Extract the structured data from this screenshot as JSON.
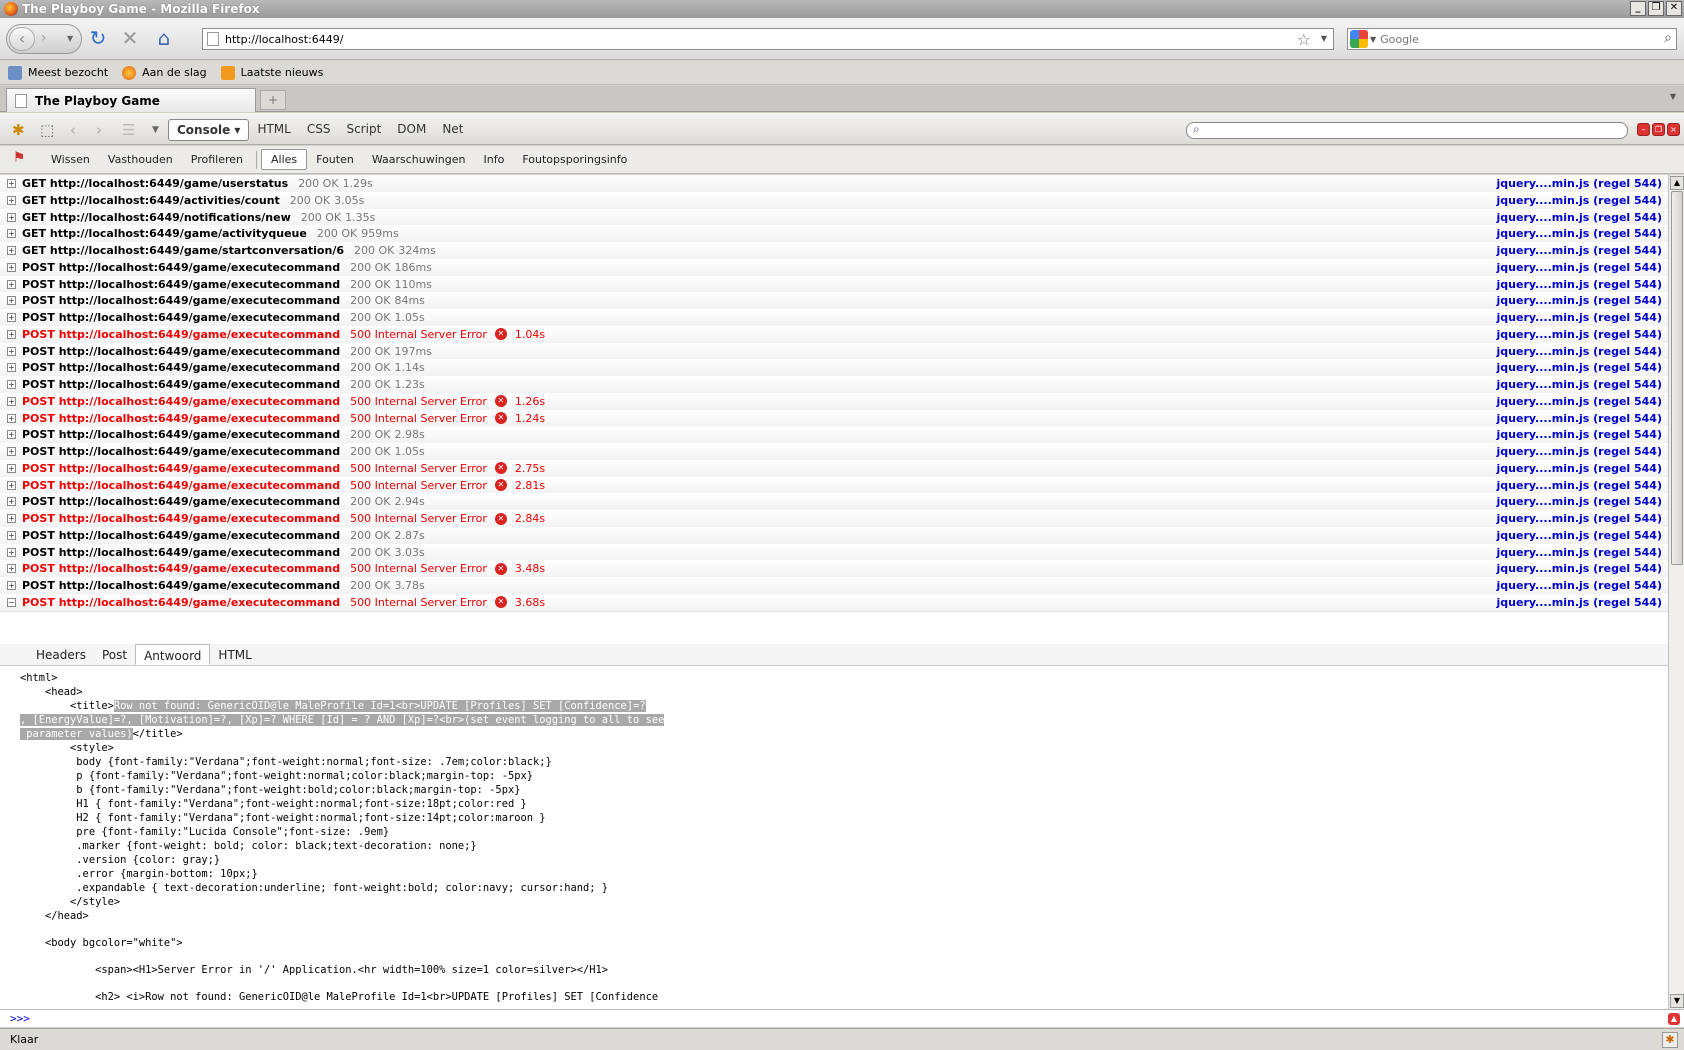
{
  "window": {
    "title": "The Playboy Game - Mozilla Firefox"
  },
  "nav": {
    "url": "http://localhost:6449/",
    "search_placeholder": "Google"
  },
  "bookmarks": [
    {
      "label": "Meest bezocht"
    },
    {
      "label": "Aan de slag"
    },
    {
      "label": "Laatste nieuws"
    }
  ],
  "tab": {
    "title": "The Playboy Game"
  },
  "firebug": {
    "tabs": [
      "Console",
      "HTML",
      "CSS",
      "Script",
      "DOM",
      "Net"
    ],
    "console_filters": [
      "Wissen",
      "Vasthouden",
      "Profileren",
      "Alles",
      "Fouten",
      "Waarschuwingen",
      "Info",
      "Foutopsporingsinfo"
    ]
  },
  "requests": [
    {
      "method": "GET",
      "url": "http://localhost:6449/game/userstatus",
      "status": "200 OK",
      "time": "1.29s",
      "source": "jquery....min.js (regel 544)",
      "error": false
    },
    {
      "method": "GET",
      "url": "http://localhost:6449/activities/count",
      "status": "200 OK",
      "time": "3.05s",
      "source": "jquery....min.js (regel 544)",
      "error": false
    },
    {
      "method": "GET",
      "url": "http://localhost:6449/notifications/new",
      "status": "200 OK",
      "time": "1.35s",
      "source": "jquery....min.js (regel 544)",
      "error": false
    },
    {
      "method": "GET",
      "url": "http://localhost:6449/game/activityqueue",
      "status": "200 OK",
      "time": "959ms",
      "source": "jquery....min.js (regel 544)",
      "error": false
    },
    {
      "method": "GET",
      "url": "http://localhost:6449/game/startconversation/6",
      "status": "200 OK",
      "time": "324ms",
      "source": "jquery....min.js (regel 544)",
      "error": false
    },
    {
      "method": "POST",
      "url": "http://localhost:6449/game/executecommand",
      "status": "200 OK",
      "time": "186ms",
      "source": "jquery....min.js (regel 544)",
      "error": false
    },
    {
      "method": "POST",
      "url": "http://localhost:6449/game/executecommand",
      "status": "200 OK",
      "time": "110ms",
      "source": "jquery....min.js (regel 544)",
      "error": false
    },
    {
      "method": "POST",
      "url": "http://localhost:6449/game/executecommand",
      "status": "200 OK",
      "time": "84ms",
      "source": "jquery....min.js (regel 544)",
      "error": false
    },
    {
      "method": "POST",
      "url": "http://localhost:6449/game/executecommand",
      "status": "200 OK",
      "time": "1.05s",
      "source": "jquery....min.js (regel 544)",
      "error": false
    },
    {
      "method": "POST",
      "url": "http://localhost:6449/game/executecommand",
      "status": "500 Internal Server Error",
      "time": "1.04s",
      "source": "jquery....min.js (regel 544)",
      "error": true
    },
    {
      "method": "POST",
      "url": "http://localhost:6449/game/executecommand",
      "status": "200 OK",
      "time": "197ms",
      "source": "jquery....min.js (regel 544)",
      "error": false
    },
    {
      "method": "POST",
      "url": "http://localhost:6449/game/executecommand",
      "status": "200 OK",
      "time": "1.14s",
      "source": "jquery....min.js (regel 544)",
      "error": false
    },
    {
      "method": "POST",
      "url": "http://localhost:6449/game/executecommand",
      "status": "200 OK",
      "time": "1.23s",
      "source": "jquery....min.js (regel 544)",
      "error": false
    },
    {
      "method": "POST",
      "url": "http://localhost:6449/game/executecommand",
      "status": "500 Internal Server Error",
      "time": "1.26s",
      "source": "jquery....min.js (regel 544)",
      "error": true
    },
    {
      "method": "POST",
      "url": "http://localhost:6449/game/executecommand",
      "status": "500 Internal Server Error",
      "time": "1.24s",
      "source": "jquery....min.js (regel 544)",
      "error": true
    },
    {
      "method": "POST",
      "url": "http://localhost:6449/game/executecommand",
      "status": "200 OK",
      "time": "2.98s",
      "source": "jquery....min.js (regel 544)",
      "error": false
    },
    {
      "method": "POST",
      "url": "http://localhost:6449/game/executecommand",
      "status": "200 OK",
      "time": "1.05s",
      "source": "jquery....min.js (regel 544)",
      "error": false
    },
    {
      "method": "POST",
      "url": "http://localhost:6449/game/executecommand",
      "status": "500 Internal Server Error",
      "time": "2.75s",
      "source": "jquery....min.js (regel 544)",
      "error": true
    },
    {
      "method": "POST",
      "url": "http://localhost:6449/game/executecommand",
      "status": "500 Internal Server Error",
      "time": "2.81s",
      "source": "jquery....min.js (regel 544)",
      "error": true
    },
    {
      "method": "POST",
      "url": "http://localhost:6449/game/executecommand",
      "status": "200 OK",
      "time": "2.94s",
      "source": "jquery....min.js (regel 544)",
      "error": false
    },
    {
      "method": "POST",
      "url": "http://localhost:6449/game/executecommand",
      "status": "500 Internal Server Error",
      "time": "2.84s",
      "source": "jquery....min.js (regel 544)",
      "error": true
    },
    {
      "method": "POST",
      "url": "http://localhost:6449/game/executecommand",
      "status": "200 OK",
      "time": "2.87s",
      "source": "jquery....min.js (regel 544)",
      "error": false
    },
    {
      "method": "POST",
      "url": "http://localhost:6449/game/executecommand",
      "status": "200 OK",
      "time": "3.03s",
      "source": "jquery....min.js (regel 544)",
      "error": false
    },
    {
      "method": "POST",
      "url": "http://localhost:6449/game/executecommand",
      "status": "500 Internal Server Error",
      "time": "3.48s",
      "source": "jquery....min.js (regel 544)",
      "error": true
    },
    {
      "method": "POST",
      "url": "http://localhost:6449/game/executecommand",
      "status": "200 OK",
      "time": "3.78s",
      "source": "jquery....min.js (regel 544)",
      "error": false
    },
    {
      "method": "POST",
      "url": "http://localhost:6449/game/executecommand",
      "status": "500 Internal Server Error",
      "time": "3.68s",
      "source": "jquery....min.js (regel 544)",
      "error": true,
      "expanded": true
    }
  ],
  "response_tabs": [
    "Headers",
    "Post",
    "Antwoord",
    "HTML"
  ],
  "response_lines": [
    {
      "text": "<html>"
    },
    {
      "text": "    <head>"
    },
    {
      "pre": "        <title>",
      "hl": "Row not found: GenericOID@le MaleProfile Id=1<br>UPDATE [Profiles] SET [Confidence]=?"
    },
    {
      "hl": ", [EnergyValue]=?, [Motivation]=?, [Xp]=? WHERE [Id] = ? AND [Xp]=?<br>(set event logging to all to see"
    },
    {
      "hl": " parameter values)",
      "post": "</title>"
    },
    {
      "text": "        <style>"
    },
    {
      "text": "         body {font-family:\"Verdana\";font-weight:normal;font-size: .7em;color:black;}"
    },
    {
      "text": "         p {font-family:\"Verdana\";font-weight:normal;color:black;margin-top: -5px}"
    },
    {
      "text": "         b {font-family:\"Verdana\";font-weight:bold;color:black;margin-top: -5px}"
    },
    {
      "text": "         H1 { font-family:\"Verdana\";font-weight:normal;font-size:18pt;color:red }"
    },
    {
      "text": "         H2 { font-family:\"Verdana\";font-weight:normal;font-size:14pt;color:maroon }"
    },
    {
      "text": "         pre {font-family:\"Lucida Console\";font-size: .9em}"
    },
    {
      "text": "         .marker {font-weight: bold; color: black;text-decoration: none;}"
    },
    {
      "text": "         .version {color: gray;}"
    },
    {
      "text": "         .error {margin-bottom: 10px;}"
    },
    {
      "text": "         .expandable { text-decoration:underline; font-weight:bold; color:navy; cursor:hand; }"
    },
    {
      "text": "        </style>"
    },
    {
      "text": "    </head>"
    },
    {
      "text": ""
    },
    {
      "text": "    <body bgcolor=\"white\">"
    },
    {
      "text": ""
    },
    {
      "text": "            <span><H1>Server Error in '/' Application.<hr width=100% size=1 color=silver></H1>"
    },
    {
      "text": ""
    },
    {
      "text": "            <h2> <i>Row not found: GenericOID@le MaleProfile Id=1<br>UPDATE [Profiles] SET [Confidence"
    }
  ],
  "command_line": {
    "prompt": ">>>"
  },
  "status": {
    "text": "Klaar"
  }
}
